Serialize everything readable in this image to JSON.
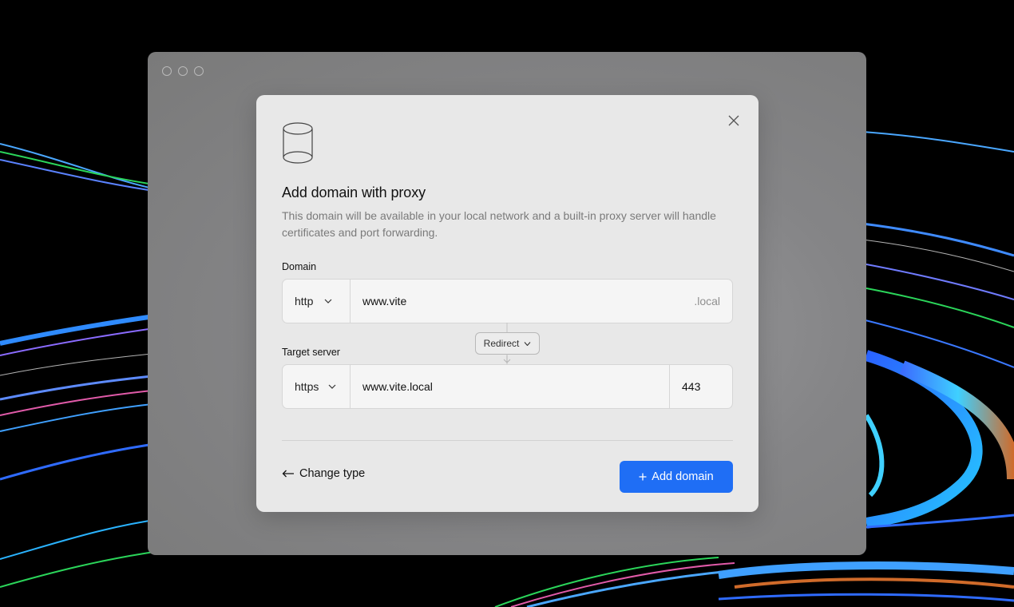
{
  "colors": {
    "accent": "#1f6ef5",
    "dialog_bg": "#e8e8e8",
    "window_bg": "#858587",
    "page_bg": "#000000"
  },
  "icons": {
    "database": "database-icon",
    "close": "close-icon",
    "chevron": "chevron-down-icon",
    "arrow_left": "arrow-left-icon",
    "plus": "plus-icon"
  },
  "dialog": {
    "title": "Add domain with proxy",
    "description": "This domain will be available in your local network and a built-in proxy server will handle certificates and port forwarding.",
    "domain": {
      "label": "Domain",
      "protocol": "http",
      "host": "www.vite",
      "suffix": ".local"
    },
    "redirect_label": "Redirect",
    "target": {
      "label": "Target server",
      "protocol": "https",
      "host": "www.vite.local",
      "port": "443"
    },
    "footer": {
      "change_type_label": "Change type",
      "add_button_label": "Add domain"
    }
  }
}
